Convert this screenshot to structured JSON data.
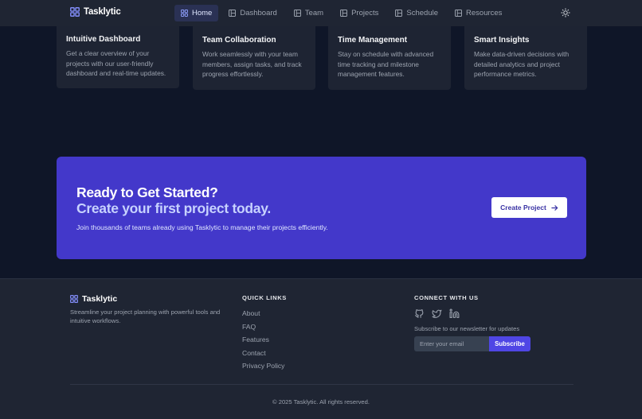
{
  "app": {
    "brand": "Tasklytic",
    "accent": "#4338ca",
    "accent_light": "#c7d2fe",
    "background": "#0f1628"
  },
  "nav": {
    "items": [
      {
        "label": "Home",
        "icon": "grid-icon",
        "active": true
      },
      {
        "label": "Dashboard",
        "icon": "layout-icon",
        "active": false
      },
      {
        "label": "Team",
        "icon": "layout-icon",
        "active": false
      },
      {
        "label": "Projects",
        "icon": "layout-icon",
        "active": false
      },
      {
        "label": "Schedule",
        "icon": "layout-icon",
        "active": false
      },
      {
        "label": "Resources",
        "icon": "layout-icon",
        "active": false
      }
    ],
    "theme_icon": "sun-icon"
  },
  "features": [
    {
      "title": "Intuitive Dashboard",
      "desc_lines": [
        "Get a clear overview of your",
        "projects with our user-friendly",
        "dashboard and real-time updates."
      ]
    },
    {
      "title": "Team Collaboration",
      "desc_lines": [
        "Work seamlessly with your team",
        "members, assign tasks, and track",
        "progress effortlessly."
      ]
    },
    {
      "title": "Time Management",
      "desc_lines": [
        "Stay on schedule with advanced",
        "time tracking and milestone",
        "management features."
      ]
    },
    {
      "title": "Smart Insights",
      "desc_lines": [
        "Make data-driven decisions with",
        "detailed analytics and project",
        "performance metrics."
      ]
    }
  ],
  "cta": {
    "heading": "Ready to Get Started?",
    "subheading": "Create your first project today.",
    "text": "Join thousands of teams already using Tasklytic to manage their projects efficiently.",
    "button_label": "Create Project"
  },
  "footer": {
    "brand": "Tasklytic",
    "tagline_lines": [
      "Streamline your project planning with powerful tools and",
      "intuitive workflows."
    ],
    "quick_links_heading": "QUICK LINKS",
    "quick_links": [
      "About",
      "FAQ",
      "Features",
      "Contact",
      "Privacy Policy"
    ],
    "connect_heading": "CONNECT WITH US",
    "socials": [
      "github-icon",
      "twitter-icon",
      "linkedin-icon"
    ],
    "newsletter_text": "Subscribe to our newsletter for updates",
    "email_placeholder": "Enter your email",
    "subscribe_label": "Subscribe",
    "copyright": "© 2025 Tasklytic. All rights reserved."
  }
}
